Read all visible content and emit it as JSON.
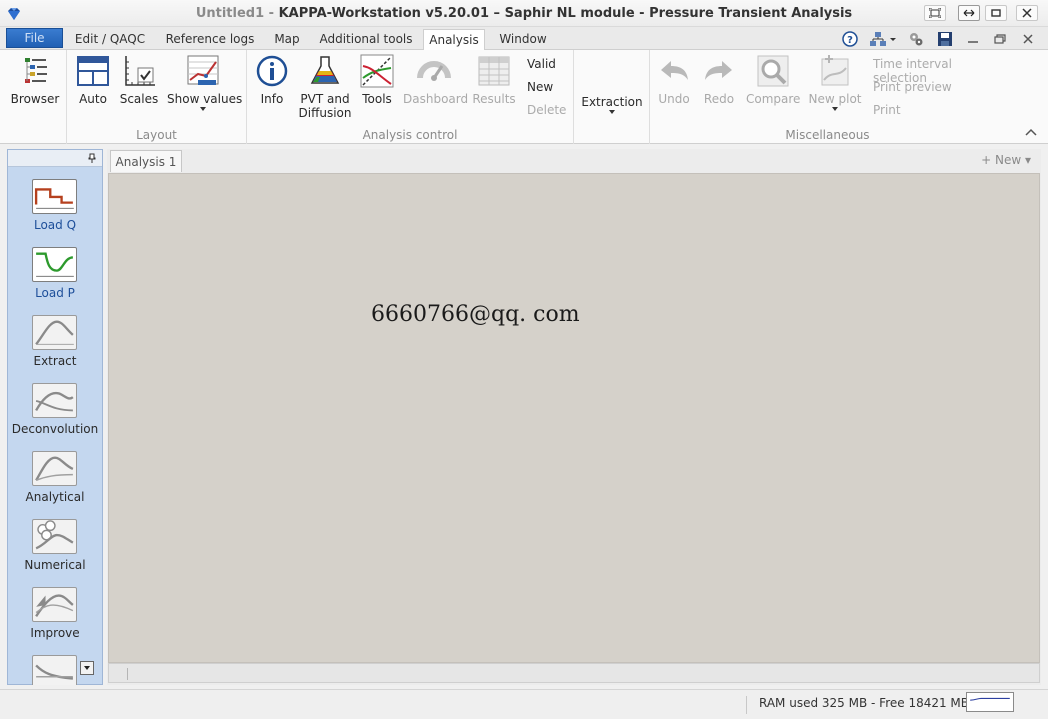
{
  "window": {
    "title_doc": "Untitled1",
    "title_sep": " - ",
    "title_app": "KAPPA-Workstation v5.20.01 – Saphir NL module - Pressure Transient Analysis"
  },
  "tabs": {
    "file": "File",
    "items": [
      {
        "label": "Edit / QAQC"
      },
      {
        "label": "Reference logs"
      },
      {
        "label": "Map"
      },
      {
        "label": "Additional tools"
      },
      {
        "label": "Analysis"
      },
      {
        "label": "Window"
      }
    ]
  },
  "ribbon": {
    "browser": "Browser",
    "layout": {
      "label": "Layout",
      "auto": "Auto",
      "scales": "Scales",
      "show_values": "Show values"
    },
    "analysis_control": {
      "label": "Analysis control",
      "info": "Info",
      "pvt_line1": "PVT and",
      "pvt_line2": "Diffusion",
      "tools": "Tools",
      "dashboard": "Dashboard",
      "results": "Results",
      "valid": "Valid",
      "new": "New",
      "delete": "Delete"
    },
    "extraction": "Extraction",
    "misc": {
      "label": "Miscellaneous",
      "undo": "Undo",
      "redo": "Redo",
      "compare": "Compare",
      "new_plot": "New plot",
      "time_interval": "Time interval selection",
      "print_preview": "Print preview",
      "print": "Print"
    }
  },
  "left_panel": {
    "items": [
      {
        "label": "Load Q"
      },
      {
        "label": "Load P"
      },
      {
        "label": "Extract"
      },
      {
        "label": "Deconvolution"
      },
      {
        "label": "Analytical"
      },
      {
        "label": "Numerical"
      },
      {
        "label": "Improve"
      }
    ]
  },
  "document": {
    "tab": "Analysis 1",
    "new_button": "New",
    "watermark": "6660766@qq. com"
  },
  "status": {
    "ram": "RAM used 325 MB - Free 18421 MB"
  },
  "colors": {
    "file_tab": "#2160b4",
    "left_panel": "#c4d7ef",
    "canvas": "#d5d1ca",
    "plot_line": "#b5401e",
    "green_line": "#2d9a2d"
  }
}
